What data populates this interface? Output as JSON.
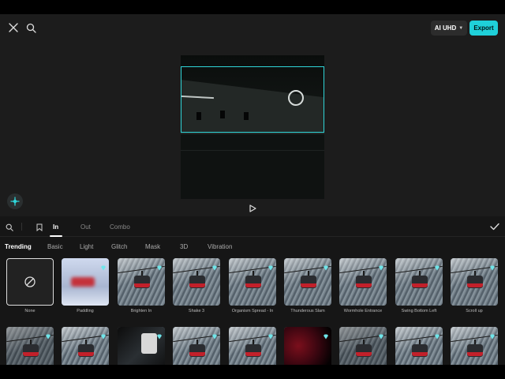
{
  "header": {
    "quality_label": "AI UHD",
    "export_label": "Export"
  },
  "tabs": [
    {
      "label": "In",
      "active": true
    },
    {
      "label": "Out",
      "active": false
    },
    {
      "label": "Combo",
      "active": false
    }
  ],
  "categories": [
    {
      "label": "Trending",
      "active": true
    },
    {
      "label": "Basic",
      "active": false
    },
    {
      "label": "Light",
      "active": false
    },
    {
      "label": "Glitch",
      "active": false
    },
    {
      "label": "Mask",
      "active": false
    },
    {
      "label": "3D",
      "active": false
    },
    {
      "label": "Vibration",
      "active": false
    }
  ],
  "effects_row1": [
    {
      "label": "None",
      "style": "none",
      "premium": false
    },
    {
      "label": "Paddling",
      "style": "blur",
      "premium": true
    },
    {
      "label": "Brighten In",
      "style": "snow",
      "premium": true
    },
    {
      "label": "Shake 3",
      "style": "snow",
      "premium": true
    },
    {
      "label": "Organism Spread - In",
      "style": "snow",
      "premium": true
    },
    {
      "label": "Thunderous Slam",
      "style": "snow",
      "premium": true
    },
    {
      "label": "Wormhole Entrance",
      "style": "snow",
      "premium": true
    },
    {
      "label": "Swing Bottom Left",
      "style": "snow",
      "premium": true
    },
    {
      "label": "Scroll up",
      "style": "snow",
      "premium": true
    }
  ],
  "effects_row2": [
    {
      "style": "dim",
      "premium": true
    },
    {
      "style": "snow",
      "premium": true
    },
    {
      "style": "dark",
      "premium": true
    },
    {
      "style": "snow",
      "premium": true
    },
    {
      "style": "snow",
      "premium": true
    },
    {
      "style": "red",
      "premium": true
    },
    {
      "style": "dim",
      "premium": true
    },
    {
      "style": "snow",
      "premium": true
    },
    {
      "style": "snow",
      "premium": true
    }
  ],
  "colors": {
    "accent": "#1fd0d9",
    "selection": "#2fd5d8",
    "background": "#161616"
  }
}
